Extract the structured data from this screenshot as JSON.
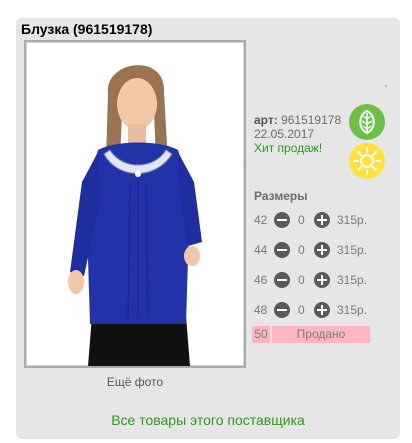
{
  "product": {
    "title": "Блузка (961519178)",
    "more_photos": "Ещё фото",
    "art_label": "арт:",
    "art_number": "961519178",
    "date": "22.05.2017",
    "hit_label": "Хит продаж!",
    "tick_mark": "'",
    "badges": [
      "leaf-icon",
      "sun-icon"
    ]
  },
  "sizes": {
    "title": "Размеры",
    "rows": [
      {
        "size": "42",
        "qty": "0",
        "price": "315р."
      },
      {
        "size": "44",
        "qty": "0",
        "price": "315р."
      },
      {
        "size": "46",
        "qty": "0",
        "price": "315р."
      },
      {
        "size": "48",
        "qty": "0",
        "price": "315р."
      }
    ],
    "sold": {
      "size": "50",
      "label": "Продано"
    }
  },
  "footer": {
    "all_supplier_link": "Все товары этого поставщика"
  },
  "colors": {
    "card_bg": "#e6e6e6",
    "accent_green": "#2a9a1a",
    "sold_bg": "#ffb6c1",
    "leaf_badge": "#6cc04a",
    "sun_badge": "#ffe23a",
    "blouse_blue": "#2233aa"
  }
}
